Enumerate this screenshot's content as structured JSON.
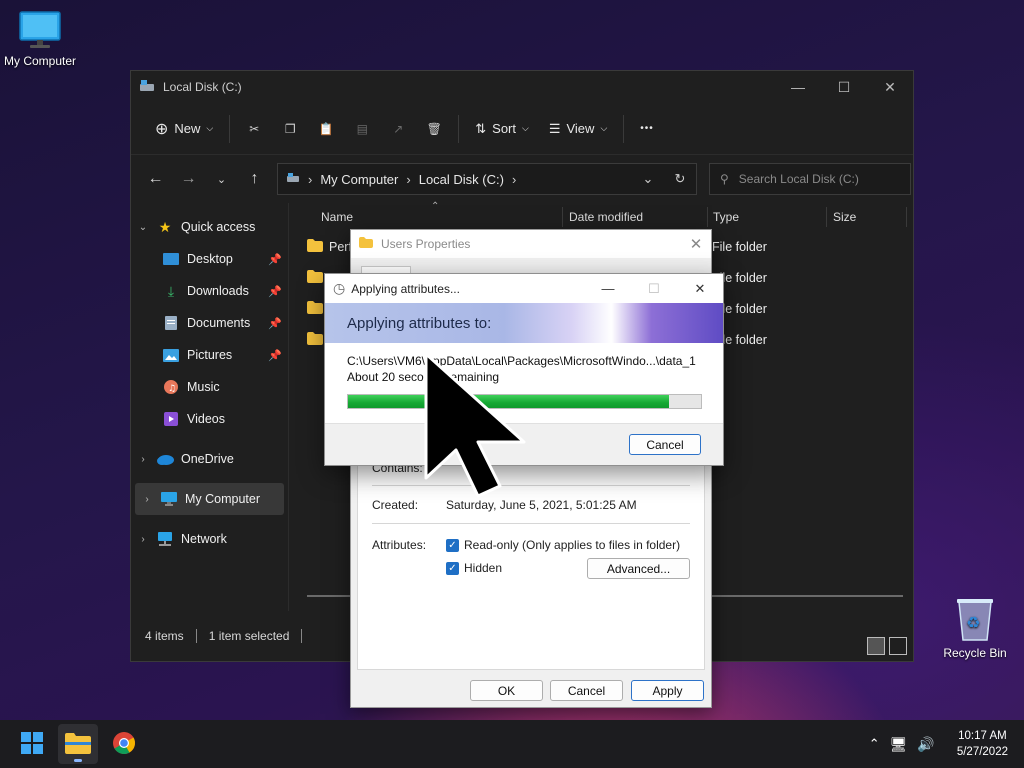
{
  "desktop": {
    "my_computer_label": "My Computer",
    "recycle_bin_label": "Recycle Bin"
  },
  "explorer": {
    "title": "Local Disk (C:)",
    "toolbar": {
      "new_label": "New",
      "sort_label": "Sort",
      "view_label": "View",
      "more_label": "•••"
    },
    "address": {
      "crumbs": [
        "My Computer",
        "Local Disk (C:)"
      ]
    },
    "search_placeholder": "Search Local Disk (C:)",
    "sidebar": {
      "quick_access": "Quick access",
      "items": [
        "Desktop",
        "Downloads",
        "Documents",
        "Pictures",
        "Music",
        "Videos"
      ],
      "onedrive": "OneDrive",
      "my_computer": "My Computer",
      "network": "Network"
    },
    "columns": {
      "name": "Name",
      "date_modified": "Date modified",
      "type": "Type",
      "size": "Size"
    },
    "rows": [
      {
        "name": "Perf",
        "type": "File folder"
      },
      {
        "name": "",
        "type": "File folder"
      },
      {
        "name": "",
        "type": "File folder"
      },
      {
        "name": "",
        "type": "File folder"
      }
    ],
    "status": {
      "items": "4 items",
      "selected": "1 item selected"
    }
  },
  "properties_dialog": {
    "title": "Users Properties",
    "contains_label": "Contains:",
    "created_label": "Created:",
    "created_value": "Saturday, June 5, 2021, 5:01:25 AM",
    "attributes_label": "Attributes:",
    "readonly_label": "Read-only (Only applies to files in folder)",
    "hidden_label": "Hidden",
    "advanced_button": "Advanced...",
    "ok_button": "OK",
    "cancel_button": "Cancel",
    "apply_button": "Apply"
  },
  "apply_dialog": {
    "title": "Applying attributes...",
    "banner": "Applying attributes to:",
    "path": "C:\\Users\\VM6\\AppData\\Local\\Packages\\MicrosoftWindo...\\data_1",
    "remaining": "About 20 seconds remaining",
    "progress": 0.91,
    "cancel_button": "Cancel"
  },
  "taskbar": {
    "time": "10:17 AM",
    "date": "5/27/2022"
  },
  "colors": {
    "accent": "#1f6fc5",
    "progress": "#16a834"
  }
}
